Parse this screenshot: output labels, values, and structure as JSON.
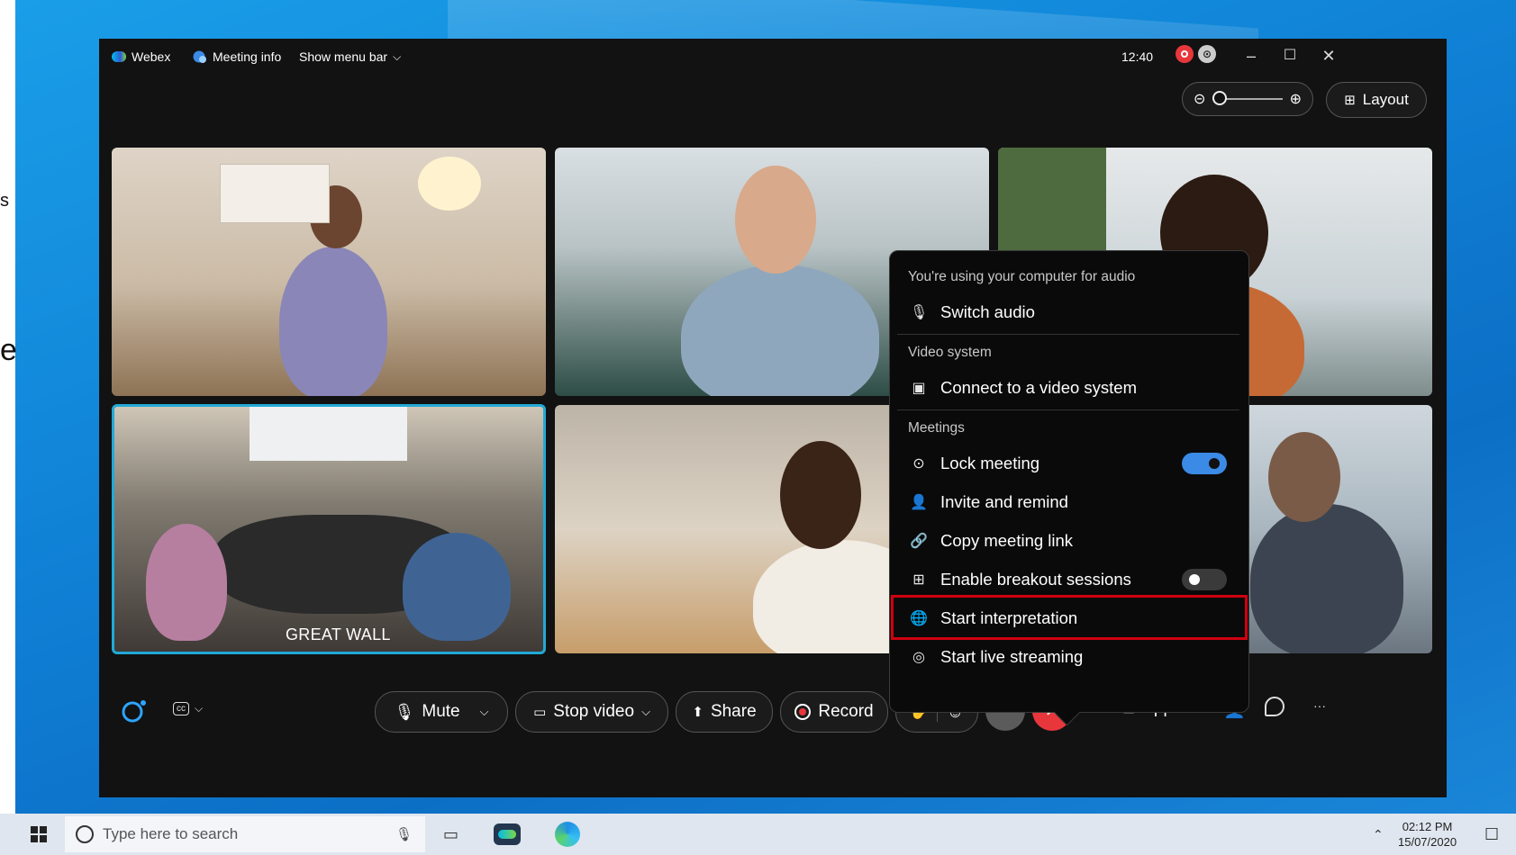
{
  "side_text": [
    "s",
    "e"
  ],
  "titlebar": {
    "app_name": "Webex",
    "meeting_info": "Meeting info",
    "show_menu_bar": "Show menu bar",
    "clock": "12:40"
  },
  "view_controls": {
    "layout_label": "Layout"
  },
  "tiles": {
    "great_wall_label": "GREAT WALL"
  },
  "menu": {
    "audio_header": "You're using your computer for audio",
    "switch_audio": "Switch audio",
    "video_header": "Video system",
    "connect_video": "Connect to a video system",
    "meetings_header": "Meetings",
    "lock_meeting": "Lock meeting",
    "lock_meeting_on": true,
    "invite_remind": "Invite and remind",
    "copy_link": "Copy meeting link",
    "breakout": "Enable breakout sessions",
    "breakout_on": false,
    "start_interpretation": "Start interpretation",
    "start_streaming": "Start live streaming"
  },
  "controls": {
    "mute": "Mute",
    "stop_video": "Stop video",
    "share": "Share",
    "record": "Record",
    "apps": "Apps",
    "more": "···"
  },
  "taskbar": {
    "search_placeholder": "Type here to search",
    "time": "02:12 PM",
    "date": "15/07/2020"
  },
  "colors": {
    "accent_blue": "#3b8ae6",
    "end_call_red": "#e8373c",
    "highlight_red": "#d00010",
    "active_tile_border": "#22a9d6"
  }
}
